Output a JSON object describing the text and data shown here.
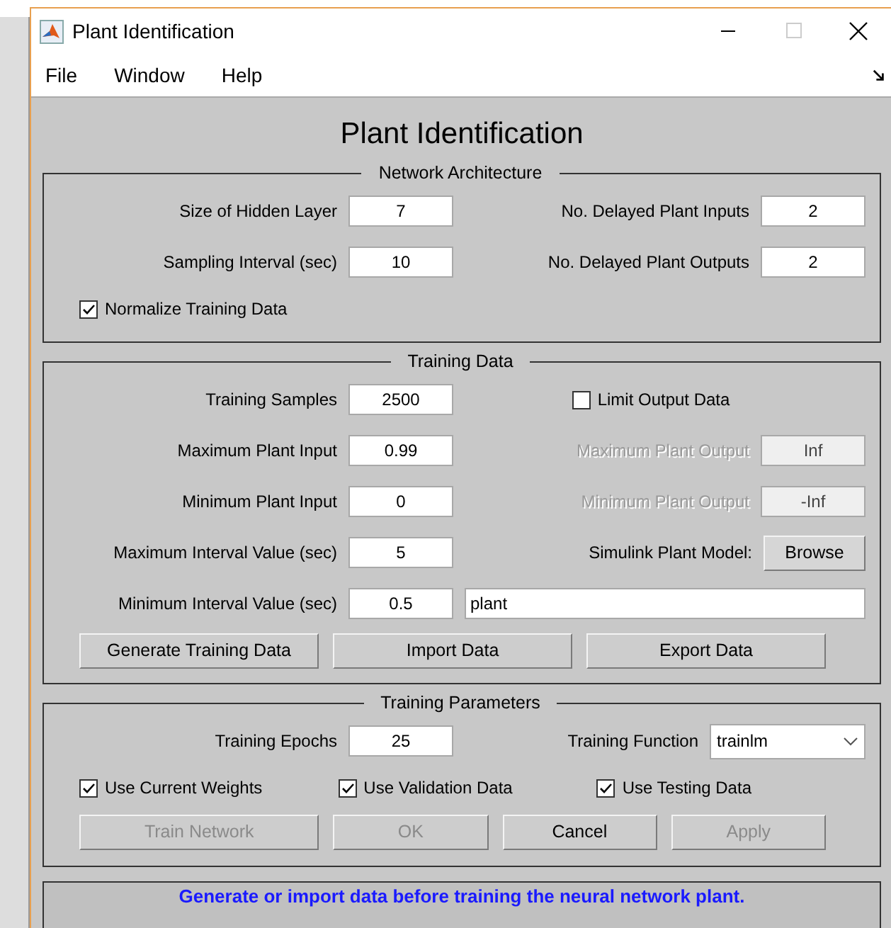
{
  "window": {
    "title": "Plant Identification"
  },
  "menu": [
    "File",
    "Window",
    "Help"
  ],
  "heading": "Plant Identification",
  "panels": [
    {
      "title": "Network Architecture",
      "rows": [
        {
          "kind": "grid",
          "items": [
            {
              "kind": "label",
              "text": "Size of Hidden Layer",
              "disabled": false
            },
            {
              "kind": "field",
              "value": "7",
              "disabled": false
            },
            {
              "kind": "label",
              "text": "No. Delayed Plant Inputs",
              "disabled": false
            },
            {
              "kind": "field",
              "value": "2",
              "disabled": false
            }
          ]
        },
        {
          "kind": "grid",
          "items": [
            {
              "kind": "label",
              "text": "Sampling Interval (sec)",
              "disabled": false
            },
            {
              "kind": "field",
              "value": "10",
              "disabled": false
            },
            {
              "kind": "label",
              "text": "No. Delayed Plant Outputs",
              "disabled": false
            },
            {
              "kind": "field",
              "value": "2",
              "disabled": false
            }
          ]
        },
        {
          "kind": "bar",
          "items": [
            {
              "kind": "checkbox",
              "label": "Normalize Training Data",
              "checked": true
            }
          ]
        }
      ]
    },
    {
      "title": "Training Data",
      "rows": [
        {
          "kind": "grid",
          "items": [
            {
              "kind": "label",
              "text": "Training Samples",
              "disabled": false
            },
            {
              "kind": "field",
              "value": "2500",
              "disabled": false
            },
            {
              "kind": "checkbox",
              "label": "Limit Output Data",
              "checked": false
            }
          ]
        },
        {
          "kind": "grid",
          "items": [
            {
              "kind": "label",
              "text": "Maximum Plant Input",
              "disabled": false
            },
            {
              "kind": "field",
              "value": "0.99",
              "disabled": false
            },
            {
              "kind": "label",
              "text": "Maximum Plant Output",
              "disabled": true
            },
            {
              "kind": "field",
              "value": "Inf",
              "disabled": true
            }
          ]
        },
        {
          "kind": "grid",
          "items": [
            {
              "kind": "label",
              "text": "Minimum Plant Input",
              "disabled": false
            },
            {
              "kind": "field",
              "value": "0",
              "disabled": false
            },
            {
              "kind": "label",
              "text": "Minimum Plant Output",
              "disabled": true
            },
            {
              "kind": "field",
              "value": "-Inf",
              "disabled": true
            }
          ]
        },
        {
          "kind": "grid",
          "items": [
            {
              "kind": "label",
              "text": "Maximum Interval Value (sec)",
              "disabled": false
            },
            {
              "kind": "field",
              "value": "5",
              "disabled": false
            },
            {
              "kind": "label",
              "text": "Simulink Plant Model:",
              "disabled": false
            },
            {
              "kind": "button",
              "label": "Browse",
              "disabled": false
            }
          ]
        },
        {
          "kind": "grid",
          "items": [
            {
              "kind": "label",
              "text": "Minimum Interval Value (sec)",
              "disabled": false
            },
            {
              "kind": "field",
              "value": "0.5",
              "disabled": false
            },
            {
              "kind": "wide_field",
              "value": "plant"
            }
          ]
        },
        {
          "kind": "bar",
          "items": [
            {
              "kind": "button",
              "label": "Generate Training Data",
              "disabled": false
            },
            {
              "kind": "button",
              "label": "Import Data",
              "disabled": false
            },
            {
              "kind": "button",
              "label": "Export Data",
              "disabled": false
            }
          ]
        }
      ]
    },
    {
      "title": "Training Parameters",
      "rows": [
        {
          "kind": "grid",
          "items": [
            {
              "kind": "label",
              "text": "Training Epochs",
              "disabled": false
            },
            {
              "kind": "field",
              "value": "25",
              "disabled": false
            },
            {
              "kind": "label",
              "text": "Training Function",
              "disabled": false
            },
            {
              "kind": "dropdown",
              "value": "trainlm"
            }
          ]
        },
        {
          "kind": "bar",
          "items": [
            {
              "kind": "checkbox",
              "label": "Use Current Weights",
              "checked": true
            },
            {
              "kind": "checkbox",
              "label": "Use Validation Data",
              "checked": true
            },
            {
              "kind": "checkbox",
              "label": "Use Testing Data",
              "checked": true
            }
          ]
        },
        {
          "kind": "bar",
          "items": [
            {
              "kind": "button",
              "label": "Train Network",
              "disabled": true
            },
            {
              "kind": "button",
              "label": "OK",
              "disabled": true
            },
            {
              "kind": "button",
              "label": "Cancel",
              "disabled": false
            },
            {
              "kind": "button",
              "label": "Apply",
              "disabled": true
            }
          ]
        }
      ]
    }
  ],
  "status": "Generate or import data before training the neural network plant."
}
